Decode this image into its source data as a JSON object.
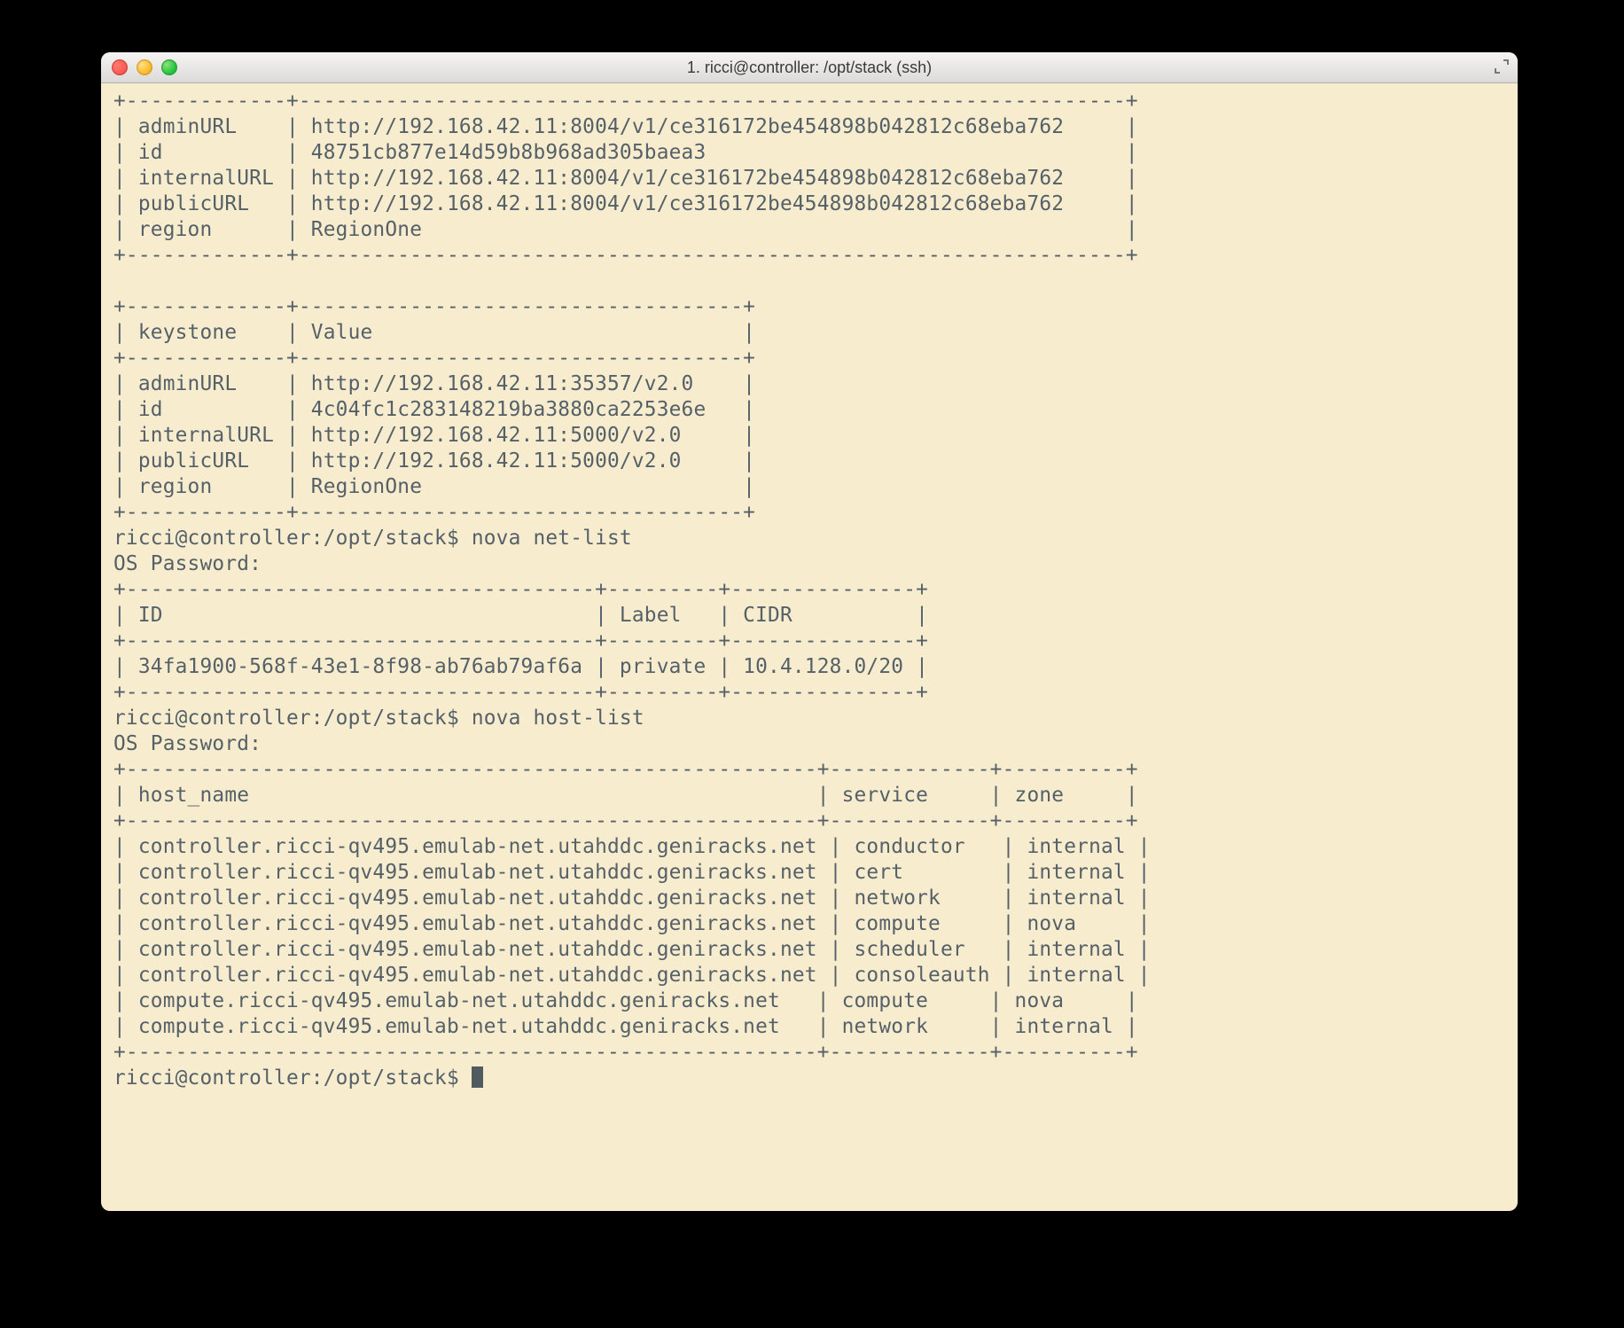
{
  "window": {
    "title": "1. ricci@controller: /opt/stack (ssh)"
  },
  "colors": {
    "term_bg": "#f7edce",
    "term_fg": "#556068"
  },
  "traffic_lights": [
    "close-icon",
    "minimize-icon",
    "zoom-icon"
  ],
  "terminal": {
    "prompt": "ricci@controller:/opt/stack$",
    "password_prompt": "OS Password:",
    "heat_table": {
      "col1_width": 13,
      "col2_width": 67,
      "rows": [
        {
          "k": "adminURL",
          "v": "http://192.168.42.11:8004/v1/ce316172be454898b042812c68eba762"
        },
        {
          "k": "id",
          "v": "48751cb877e14d59b8b968ad305baea3"
        },
        {
          "k": "internalURL",
          "v": "http://192.168.42.11:8004/v1/ce316172be454898b042812c68eba762"
        },
        {
          "k": "publicURL",
          "v": "http://192.168.42.11:8004/v1/ce316172be454898b042812c68eba762"
        },
        {
          "k": "region",
          "v": "RegionOne"
        }
      ]
    },
    "keystone_table": {
      "col1_header": "keystone",
      "col2_header": "Value",
      "col1_width": 13,
      "col2_width": 36,
      "rows": [
        {
          "k": "adminURL",
          "v": "http://192.168.42.11:35357/v2.0"
        },
        {
          "k": "id",
          "v": "4c04fc1c283148219ba3880ca2253e6e"
        },
        {
          "k": "internalURL",
          "v": "http://192.168.42.11:5000/v2.0"
        },
        {
          "k": "publicURL",
          "v": "http://192.168.42.11:5000/v2.0"
        },
        {
          "k": "region",
          "v": "RegionOne"
        }
      ]
    },
    "commands": [
      "nova net-list",
      "nova host-list"
    ],
    "net_list_table": {
      "headers": [
        "ID",
        "Label",
        "CIDR"
      ],
      "widths": [
        38,
        9,
        15
      ],
      "rows": [
        {
          "id": "34fa1900-568f-43e1-8f98-ab76ab79af6a",
          "label": "private",
          "cidr": "10.4.128.0/20"
        }
      ]
    },
    "host_list_table": {
      "headers": [
        "host_name",
        "service",
        "zone"
      ],
      "widths": [
        56,
        13,
        10
      ],
      "rows": [
        {
          "host": "controller.ricci-qv495.emulab-net.utahddc.geniracks.net",
          "service": "conductor",
          "zone": "internal"
        },
        {
          "host": "controller.ricci-qv495.emulab-net.utahddc.geniracks.net",
          "service": "cert",
          "zone": "internal"
        },
        {
          "host": "controller.ricci-qv495.emulab-net.utahddc.geniracks.net",
          "service": "network",
          "zone": "internal"
        },
        {
          "host": "controller.ricci-qv495.emulab-net.utahddc.geniracks.net",
          "service": "compute",
          "zone": "nova"
        },
        {
          "host": "controller.ricci-qv495.emulab-net.utahddc.geniracks.net",
          "service": "scheduler",
          "zone": "internal"
        },
        {
          "host": "controller.ricci-qv495.emulab-net.utahddc.geniracks.net",
          "service": "consoleauth",
          "zone": "internal"
        },
        {
          "host": "compute.ricci-qv495.emulab-net.utahddc.geniracks.net",
          "service": "compute",
          "zone": "nova"
        },
        {
          "host": "compute.ricci-qv495.emulab-net.utahddc.geniracks.net",
          "service": "network",
          "zone": "internal"
        }
      ]
    }
  }
}
